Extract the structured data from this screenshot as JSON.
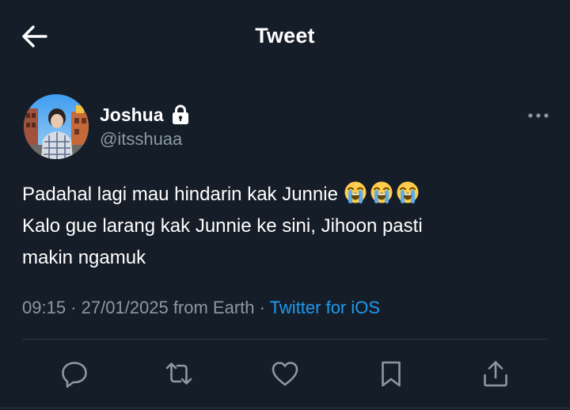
{
  "header": {
    "title": "Tweet",
    "back_icon": "arrow-left-icon"
  },
  "tweet": {
    "author": {
      "display_name": "Joshua",
      "handle": "@itsshuaa",
      "protected_icon": "lock-icon"
    },
    "more_icon": "ellipsis-icon",
    "text_lines": [
      "Padahal lagi mau hindarin kak Junnie",
      "Kalo gue larang kak Junnie ke sini, Jihoon pasti",
      "makin ngamuk"
    ],
    "emojis": [
      "loudly-crying-face",
      "loudly-crying-face",
      "loudly-crying-face"
    ],
    "meta": {
      "timestamp": "09:15 · 27/01/2025 from Earth · ",
      "client": "Twitter for iOS"
    }
  },
  "actions": [
    {
      "name": "reply",
      "icon": "reply-bubble-icon"
    },
    {
      "name": "retweet",
      "icon": "retweet-icon"
    },
    {
      "name": "like",
      "icon": "heart-icon"
    },
    {
      "name": "bookmark",
      "icon": "bookmark-icon"
    },
    {
      "name": "share",
      "icon": "share-icon"
    }
  ],
  "colors": {
    "background": "#151d28",
    "text_primary": "#ffffff",
    "text_secondary": "#8b98a5",
    "accent": "#1d9bf0",
    "divider": "#2f3a46"
  }
}
